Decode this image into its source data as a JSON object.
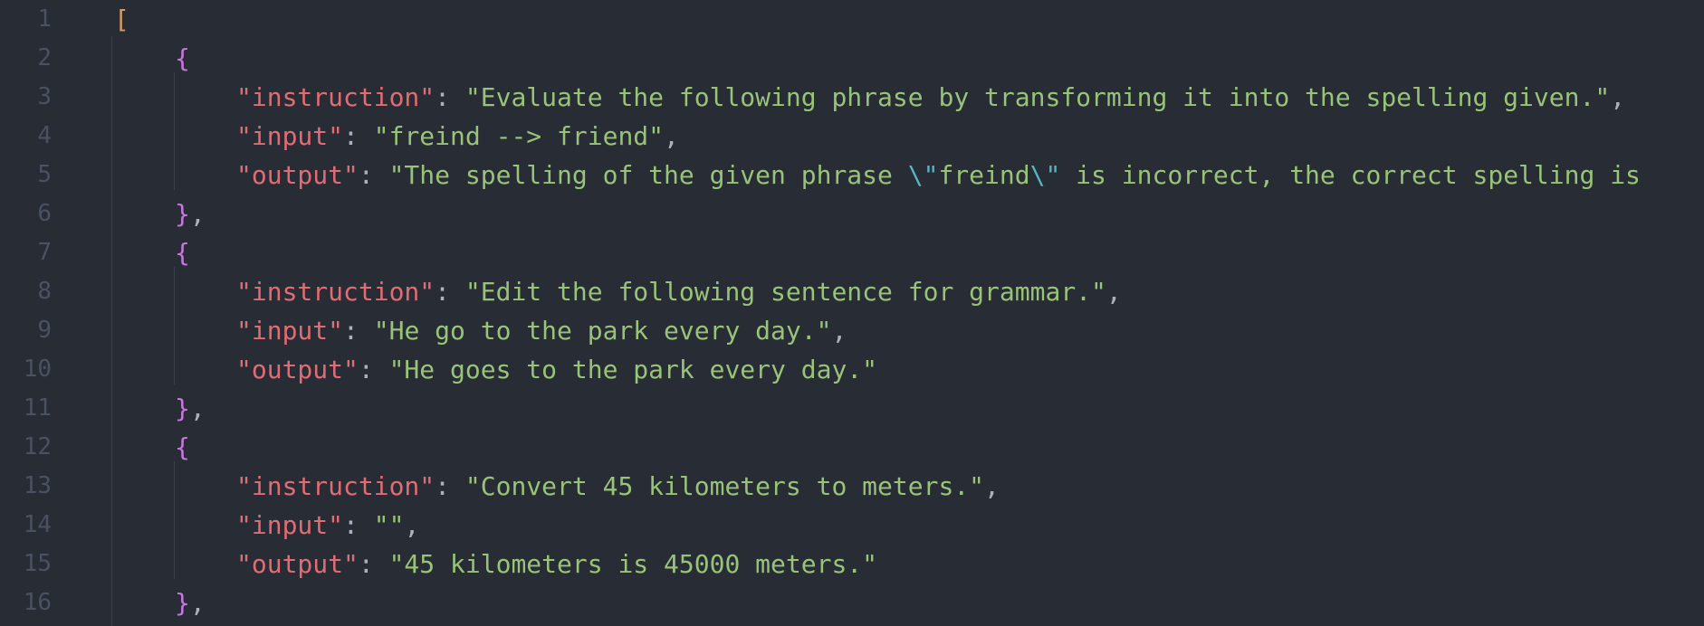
{
  "editor": {
    "line_numbers": [
      "1",
      "2",
      "3",
      "4",
      "5",
      "6",
      "7",
      "8",
      "9",
      "10",
      "11",
      "12",
      "13",
      "14",
      "15",
      "16"
    ],
    "lines": [
      {
        "indent": 0,
        "tokens": [
          {
            "t": "bracket",
            "v": "["
          }
        ]
      },
      {
        "indent": 1,
        "tokens": [
          {
            "t": "brace",
            "v": "{"
          }
        ]
      },
      {
        "indent": 2,
        "tokens": [
          {
            "t": "key",
            "v": "\"instruction\""
          },
          {
            "t": "punc",
            "v": ": "
          },
          {
            "t": "str",
            "v": "\"Evaluate the following phrase by transforming it into the spelling given.\""
          },
          {
            "t": "punc",
            "v": ","
          }
        ]
      },
      {
        "indent": 2,
        "tokens": [
          {
            "t": "key",
            "v": "\"input\""
          },
          {
            "t": "punc",
            "v": ": "
          },
          {
            "t": "str",
            "v": "\"freind --> friend\""
          },
          {
            "t": "punc",
            "v": ","
          }
        ]
      },
      {
        "indent": 2,
        "tokens": [
          {
            "t": "key",
            "v": "\"output\""
          },
          {
            "t": "punc",
            "v": ": "
          },
          {
            "t": "str",
            "v": "\"The spelling of the given phrase "
          },
          {
            "t": "esc",
            "v": "\\\""
          },
          {
            "t": "str",
            "v": "freind"
          },
          {
            "t": "esc",
            "v": "\\\""
          },
          {
            "t": "str",
            "v": " is incorrect, the correct spelling is"
          }
        ]
      },
      {
        "indent": 1,
        "tokens": [
          {
            "t": "brace",
            "v": "}"
          },
          {
            "t": "punc",
            "v": ","
          }
        ]
      },
      {
        "indent": 1,
        "tokens": [
          {
            "t": "brace",
            "v": "{"
          }
        ]
      },
      {
        "indent": 2,
        "tokens": [
          {
            "t": "key",
            "v": "\"instruction\""
          },
          {
            "t": "punc",
            "v": ": "
          },
          {
            "t": "str",
            "v": "\"Edit the following sentence for grammar.\""
          },
          {
            "t": "punc",
            "v": ","
          }
        ]
      },
      {
        "indent": 2,
        "tokens": [
          {
            "t": "key",
            "v": "\"input\""
          },
          {
            "t": "punc",
            "v": ": "
          },
          {
            "t": "str",
            "v": "\"He go to the park every day.\""
          },
          {
            "t": "punc",
            "v": ","
          }
        ]
      },
      {
        "indent": 2,
        "tokens": [
          {
            "t": "key",
            "v": "\"output\""
          },
          {
            "t": "punc",
            "v": ": "
          },
          {
            "t": "str",
            "v": "\"He goes to the park every day.\""
          }
        ]
      },
      {
        "indent": 1,
        "tokens": [
          {
            "t": "brace",
            "v": "}"
          },
          {
            "t": "punc",
            "v": ","
          }
        ]
      },
      {
        "indent": 1,
        "tokens": [
          {
            "t": "brace",
            "v": "{"
          }
        ]
      },
      {
        "indent": 2,
        "tokens": [
          {
            "t": "key",
            "v": "\"instruction\""
          },
          {
            "t": "punc",
            "v": ": "
          },
          {
            "t": "str",
            "v": "\"Convert 45 kilometers to meters.\""
          },
          {
            "t": "punc",
            "v": ","
          }
        ]
      },
      {
        "indent": 2,
        "tokens": [
          {
            "t": "key",
            "v": "\"input\""
          },
          {
            "t": "punc",
            "v": ": "
          },
          {
            "t": "str",
            "v": "\"\""
          },
          {
            "t": "punc",
            "v": ","
          }
        ]
      },
      {
        "indent": 2,
        "tokens": [
          {
            "t": "key",
            "v": "\"output\""
          },
          {
            "t": "punc",
            "v": ": "
          },
          {
            "t": "str",
            "v": "\"45 kilometers is 45000 meters.\""
          }
        ]
      },
      {
        "indent": 1,
        "tokens": [
          {
            "t": "brace",
            "v": "}"
          },
          {
            "t": "punc",
            "v": ","
          }
        ]
      }
    ]
  },
  "colors": {
    "background": "#282c34",
    "line_number": "#495162",
    "key": "#e06c75",
    "string": "#98c379",
    "escape": "#56b6c2",
    "punctuation": "#abb2bf",
    "brace": "#c678dd",
    "bracket": "#d19a66",
    "indent_guide": "#3b4048"
  }
}
